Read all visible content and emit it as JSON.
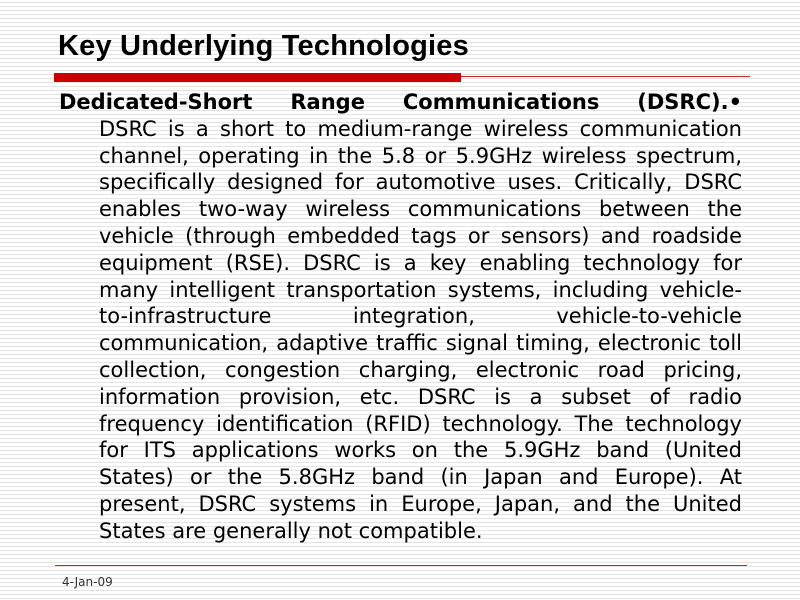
{
  "slide": {
    "title": "Key Underlying Technologies",
    "lead": "Dedicated-Short Range Communications (DSRC).•",
    "paragraph": "DSRC is a short to medium-range wireless communication channel, operating in the 5.8 or 5.9GHz wireless spectrum, specifically designed for automotive uses. Critically, DSRC enables two-way wireless communications between the vehicle (through embedded tags or sensors) and roadside equipment (RSE). DSRC is a key enabling technology for many intelligent transportation systems, including vehicle-to-infrastructure integration, vehicle-to-vehicle communication, adaptive traffic signal timing, electronic toll collection, congestion charging, electronic road pricing, information provision, etc. DSRC is a subset of radio frequency identification (RFID) technology. The technology for ITS applications works on the 5.9GHz band (United States) or the 5.8GHz band (in Japan and Europe). At present, DSRC systems in Europe, Japan, and the United States are generally not compatible."
  },
  "footer": {
    "date": "4-Jan-09"
  },
  "colors": {
    "accent": "#cc0000"
  }
}
